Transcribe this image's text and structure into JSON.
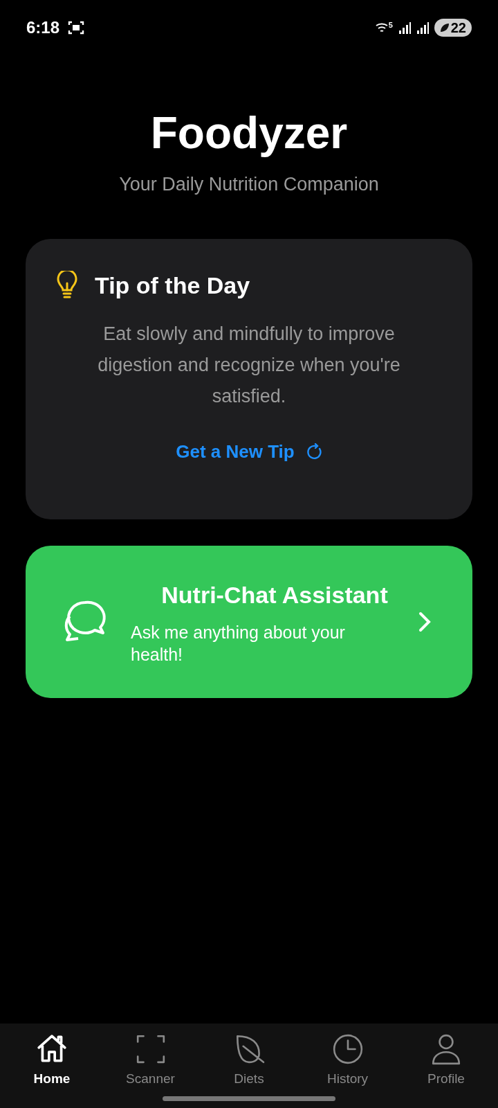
{
  "status_bar": {
    "time": "6:18",
    "network": "5",
    "battery": "22"
  },
  "header": {
    "title": "Foodyzer",
    "subtitle": "Your Daily Nutrition Companion"
  },
  "tip_card": {
    "title": "Tip of the Day",
    "text": "Eat slowly and mindfully to improve digestion and recognize when you're satisfied.",
    "action": "Get a New Tip"
  },
  "chat_card": {
    "title": "Nutri-Chat Assistant",
    "subtitle": "Ask me anything about your health!"
  },
  "tabs": [
    {
      "kind": "home",
      "label": "Home",
      "selected": true
    },
    {
      "kind": "scanner",
      "label": "Scanner",
      "selected": false
    },
    {
      "kind": "diets",
      "label": "Diets",
      "selected": false
    },
    {
      "kind": "history",
      "label": "History",
      "selected": false
    },
    {
      "kind": "profile",
      "label": "Profile",
      "selected": false
    }
  ]
}
